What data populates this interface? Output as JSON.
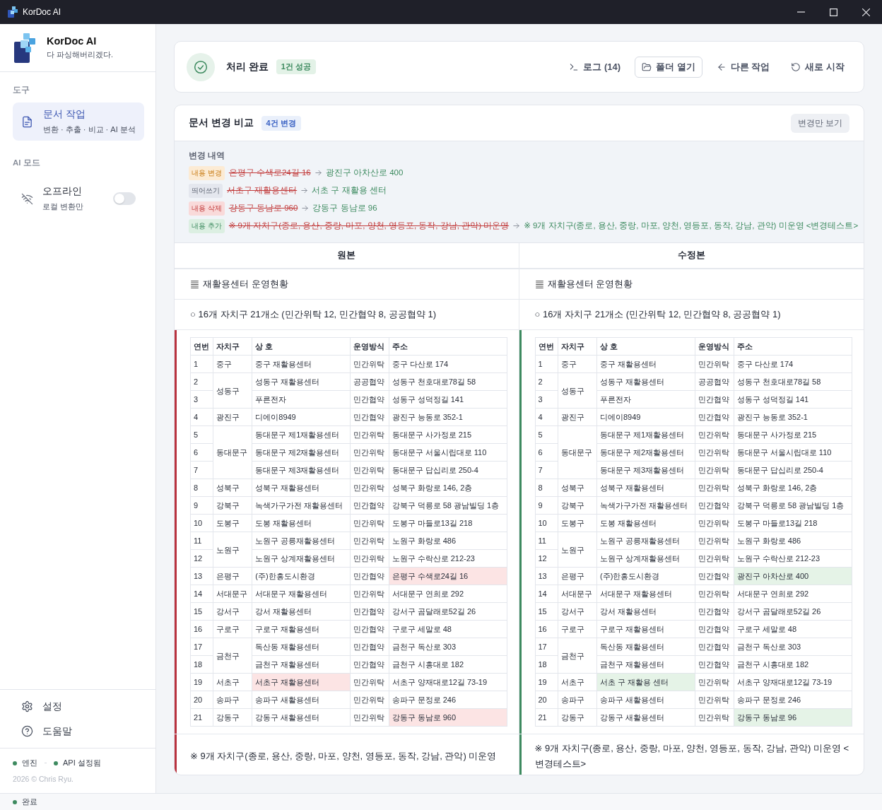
{
  "window": {
    "title": "KorDoc AI"
  },
  "sidebar": {
    "brand": {
      "name": "KorDoc AI",
      "tagline": "다 파싱해버리겠다."
    },
    "tools_label": "도구",
    "nav": [
      {
        "title": "문서 작업",
        "subtitle": "변환 · 추출 · 비교 · AI 분석",
        "selected": true
      }
    ],
    "ai_mode": {
      "label": "AI 모드",
      "title": "오프라인",
      "subtitle": "로컬 변환만",
      "on": false
    },
    "links": [
      {
        "kind": "settings",
        "label": "설정"
      },
      {
        "kind": "help",
        "label": "도움말"
      }
    ],
    "indicators": [
      {
        "label": "엔진",
        "color": "#3d8a5f"
      },
      {
        "label": "API 설정됨",
        "color": "#3d8a5f"
      }
    ],
    "copyright": "2026 © Chris Ryu."
  },
  "result": {
    "title": "처리 완료",
    "badge": "1건 성공",
    "actions": [
      {
        "kind": "log",
        "label": "로그 (14)",
        "outlined": false
      },
      {
        "kind": "folder",
        "label": "폴더 열기",
        "outlined": true
      },
      {
        "kind": "back",
        "label": "다른 작업",
        "outlined": false
      },
      {
        "kind": "restart",
        "label": "새로 시작",
        "outlined": false
      }
    ]
  },
  "comparison": {
    "title": "문서 변경 비교",
    "badge": "4건 변경",
    "filter_button": "변경만 보기",
    "changes_label": "변경 내역",
    "changes": [
      {
        "kind": "modify",
        "label": "내용 변경",
        "old": "은평구 수색로24길 16",
        "new": "광진구 아차산로 400"
      },
      {
        "kind": "spacing",
        "label": "띄어쓰기",
        "old": "서초구 재활용센터",
        "new": "서초 구 재활용 센터"
      },
      {
        "kind": "delete",
        "label": "내용 삭제",
        "old": "강동구 동남로 960",
        "new": "강동구 동남로 96"
      },
      {
        "kind": "add",
        "label": "내용 추가",
        "old": "※ 9개 자치구(종로, 용산, 중랑, 마포, 양천, 영등포, 동작, 강남, 관악) 미운영",
        "new": "※ 9개 자치구(종로, 용산, 중랑, 마포, 양천, 영등포, 동작, 강남, 관악) 미운영 <변경테스트>"
      }
    ],
    "panes": [
      {
        "kind": "original",
        "label": "원본",
        "blocks": [
          {
            "kind": "heading",
            "text": "재활용센터 운영현황",
            "changed": false
          },
          {
            "kind": "paragraph",
            "text": "○ 16개 자치구 21개소 (민간위탁 12, 민간협약 8, 공공협약 1)",
            "changed": false
          },
          {
            "kind": "table",
            "changed": true,
            "columns": [
              "연번",
              "자치구",
              "상 호",
              "운영방식",
              "주소"
            ],
            "groups": [
              {
                "district": "중구",
                "entries": [
                  {
                    "no": "1",
                    "name": "중구 재활용센터",
                    "method": "민간위탁",
                    "address": "중구 다산로 174",
                    "name_changed": false,
                    "address_changed": false
                  }
                ]
              },
              {
                "district": "성동구",
                "entries": [
                  {
                    "no": "2",
                    "name": "성동구 재활용센터",
                    "method": "공공협약",
                    "address": "성동구 천호대로78길 58",
                    "name_changed": false,
                    "address_changed": false
                  },
                  {
                    "no": "3",
                    "name": "푸른전자",
                    "method": "민간협약",
                    "address": "성동구 성덕정길 141",
                    "name_changed": false,
                    "address_changed": false
                  }
                ]
              },
              {
                "district": "광진구",
                "entries": [
                  {
                    "no": "4",
                    "name": "디에이8949",
                    "method": "민간협약",
                    "address": "광진구 능동로 352-1",
                    "name_changed": false,
                    "address_changed": false
                  }
                ]
              },
              {
                "district": "동대문구",
                "entries": [
                  {
                    "no": "5",
                    "name": "동대문구 제1재활용센터",
                    "method": "민간위탁",
                    "address": "동대문구 사가정로 215",
                    "name_changed": false,
                    "address_changed": false
                  },
                  {
                    "no": "6",
                    "name": "동대문구 제2재활용센터",
                    "method": "민간위탁",
                    "address": "동대문구 서울시립대로 110",
                    "name_changed": false,
                    "address_changed": false
                  },
                  {
                    "no": "7",
                    "name": "동대문구 제3재활용센터",
                    "method": "민간위탁",
                    "address": "동대문구 답십리로 250-4",
                    "name_changed": false,
                    "address_changed": false
                  }
                ]
              },
              {
                "district": "성북구",
                "entries": [
                  {
                    "no": "8",
                    "name": "성북구 재활용센터",
                    "method": "민간위탁",
                    "address": "성북구 화랑로 146, 2층",
                    "name_changed": false,
                    "address_changed": false
                  }
                ]
              },
              {
                "district": "강북구",
                "entries": [
                  {
                    "no": "9",
                    "name": "녹색가구가전 재활용센터",
                    "method": "민간협약",
                    "address": "강북구 덕릉로 58 광남빌딩 1층",
                    "name_changed": false,
                    "address_changed": false
                  }
                ]
              },
              {
                "district": "도봉구",
                "entries": [
                  {
                    "no": "10",
                    "name": "도봉 재활용센터",
                    "method": "민간위탁",
                    "address": "도봉구 마들로13길 218",
                    "name_changed": false,
                    "address_changed": false
                  }
                ]
              },
              {
                "district": "노원구",
                "entries": [
                  {
                    "no": "11",
                    "name": "노원구 공릉재활용센터",
                    "method": "민간위탁",
                    "address": "노원구 화랑로 486",
                    "name_changed": false,
                    "address_changed": false
                  },
                  {
                    "no": "12",
                    "name": "노원구 상계재활용센터",
                    "method": "민간위탁",
                    "address": "노원구 수락산로 212-23",
                    "name_changed": false,
                    "address_changed": false
                  }
                ]
              },
              {
                "district": "은평구",
                "entries": [
                  {
                    "no": "13",
                    "name": "(주)한흥도시환경",
                    "method": "민간협약",
                    "address": "은평구 수색로24길 16",
                    "name_changed": false,
                    "address_changed": true
                  }
                ]
              },
              {
                "district": "서대문구",
                "entries": [
                  {
                    "no": "14",
                    "name": "서대문구 재활용센터",
                    "method": "민간위탁",
                    "address": "서대문구 연희로 292",
                    "name_changed": false,
                    "address_changed": false
                  }
                ]
              },
              {
                "district": "강서구",
                "entries": [
                  {
                    "no": "15",
                    "name": "강서 재활용센터",
                    "method": "민간협약",
                    "address": "강서구 곰달래로52길 26",
                    "name_changed": false,
                    "address_changed": false
                  }
                ]
              },
              {
                "district": "구로구",
                "entries": [
                  {
                    "no": "16",
                    "name": "구로구 재활용센터",
                    "method": "민간협약",
                    "address": "구로구 세말로 48",
                    "name_changed": false,
                    "address_changed": false
                  }
                ]
              },
              {
                "district": "금천구",
                "entries": [
                  {
                    "no": "17",
                    "name": "독산동 재활용센터",
                    "method": "민간협약",
                    "address": "금천구 독산로 303",
                    "name_changed": false,
                    "address_changed": false
                  },
                  {
                    "no": "18",
                    "name": "금천구 재활용센터",
                    "method": "민간협약",
                    "address": "금천구 시흥대로 182",
                    "name_changed": false,
                    "address_changed": false
                  }
                ]
              },
              {
                "district": "서초구",
                "entries": [
                  {
                    "no": "19",
                    "name": "서초구 재활용센터",
                    "method": "민간위탁",
                    "address": "서초구 양재대로12길 73-19",
                    "name_changed": true,
                    "address_changed": false
                  }
                ]
              },
              {
                "district": "송파구",
                "entries": [
                  {
                    "no": "20",
                    "name": "송파구 새활용센터",
                    "method": "민간위탁",
                    "address": "송파구 문정로 246",
                    "name_changed": false,
                    "address_changed": false
                  }
                ]
              },
              {
                "district": "강동구",
                "entries": [
                  {
                    "no": "21",
                    "name": "강동구 새활용센터",
                    "method": "민간위탁",
                    "address": "강동구 동남로 960",
                    "name_changed": false,
                    "address_changed": true
                  }
                ]
              }
            ]
          },
          {
            "kind": "paragraph",
            "text": "※ 9개 자치구(종로, 용산, 중랑, 마포, 양천, 영등포, 동작, 강남, 관악) 미운영",
            "changed": true
          }
        ]
      },
      {
        "kind": "revised",
        "label": "수정본",
        "blocks": [
          {
            "kind": "heading",
            "text": "재활용센터 운영현황",
            "changed": false
          },
          {
            "kind": "paragraph",
            "text": "○ 16개 자치구 21개소 (민간위탁 12, 민간협약 8, 공공협약 1)",
            "changed": false
          },
          {
            "kind": "table",
            "changed": true,
            "columns": [
              "연번",
              "자치구",
              "상 호",
              "운영방식",
              "주소"
            ],
            "groups": [
              {
                "district": "중구",
                "entries": [
                  {
                    "no": "1",
                    "name": "중구 재활용센터",
                    "method": "민간위탁",
                    "address": "중구 다산로 174",
                    "name_changed": false,
                    "address_changed": false
                  }
                ]
              },
              {
                "district": "성동구",
                "entries": [
                  {
                    "no": "2",
                    "name": "성동구 재활용센터",
                    "method": "공공협약",
                    "address": "성동구 천호대로78길 58",
                    "name_changed": false,
                    "address_changed": false
                  },
                  {
                    "no": "3",
                    "name": "푸른전자",
                    "method": "민간협약",
                    "address": "성동구 성덕정길 141",
                    "name_changed": false,
                    "address_changed": false
                  }
                ]
              },
              {
                "district": "광진구",
                "entries": [
                  {
                    "no": "4",
                    "name": "디에이8949",
                    "method": "민간협약",
                    "address": "광진구 능동로 352-1",
                    "name_changed": false,
                    "address_changed": false
                  }
                ]
              },
              {
                "district": "동대문구",
                "entries": [
                  {
                    "no": "5",
                    "name": "동대문구 제1재활용센터",
                    "method": "민간위탁",
                    "address": "동대문구 사가정로 215",
                    "name_changed": false,
                    "address_changed": false
                  },
                  {
                    "no": "6",
                    "name": "동대문구 제2재활용센터",
                    "method": "민간위탁",
                    "address": "동대문구 서울시립대로 110",
                    "name_changed": false,
                    "address_changed": false
                  },
                  {
                    "no": "7",
                    "name": "동대문구 제3재활용센터",
                    "method": "민간위탁",
                    "address": "동대문구 답십리로 250-4",
                    "name_changed": false,
                    "address_changed": false
                  }
                ]
              },
              {
                "district": "성북구",
                "entries": [
                  {
                    "no": "8",
                    "name": "성북구 재활용센터",
                    "method": "민간위탁",
                    "address": "성북구 화랑로 146, 2층",
                    "name_changed": false,
                    "address_changed": false
                  }
                ]
              },
              {
                "district": "강북구",
                "entries": [
                  {
                    "no": "9",
                    "name": "녹색가구가전 재활용센터",
                    "method": "민간협약",
                    "address": "강북구 덕릉로 58 광남빌딩 1층",
                    "name_changed": false,
                    "address_changed": false
                  }
                ]
              },
              {
                "district": "도봉구",
                "entries": [
                  {
                    "no": "10",
                    "name": "도봉 재활용센터",
                    "method": "민간위탁",
                    "address": "도봉구 마들로13길 218",
                    "name_changed": false,
                    "address_changed": false
                  }
                ]
              },
              {
                "district": "노원구",
                "entries": [
                  {
                    "no": "11",
                    "name": "노원구 공릉재활용센터",
                    "method": "민간위탁",
                    "address": "노원구 화랑로 486",
                    "name_changed": false,
                    "address_changed": false
                  },
                  {
                    "no": "12",
                    "name": "노원구 상계재활용센터",
                    "method": "민간위탁",
                    "address": "노원구 수락산로 212-23",
                    "name_changed": false,
                    "address_changed": false
                  }
                ]
              },
              {
                "district": "은평구",
                "entries": [
                  {
                    "no": "13",
                    "name": "(주)한흥도시환경",
                    "method": "민간협약",
                    "address": "광진구 아차산로 400",
                    "name_changed": false,
                    "address_changed": true
                  }
                ]
              },
              {
                "district": "서대문구",
                "entries": [
                  {
                    "no": "14",
                    "name": "서대문구 재활용센터",
                    "method": "민간위탁",
                    "address": "서대문구 연희로 292",
                    "name_changed": false,
                    "address_changed": false
                  }
                ]
              },
              {
                "district": "강서구",
                "entries": [
                  {
                    "no": "15",
                    "name": "강서 재활용센터",
                    "method": "민간협약",
                    "address": "강서구 곰달래로52길 26",
                    "name_changed": false,
                    "address_changed": false
                  }
                ]
              },
              {
                "district": "구로구",
                "entries": [
                  {
                    "no": "16",
                    "name": "구로구 재활용센터",
                    "method": "민간협약",
                    "address": "구로구 세말로 48",
                    "name_changed": false,
                    "address_changed": false
                  }
                ]
              },
              {
                "district": "금천구",
                "entries": [
                  {
                    "no": "17",
                    "name": "독산동 재활용센터",
                    "method": "민간협약",
                    "address": "금천구 독산로 303",
                    "name_changed": false,
                    "address_changed": false
                  },
                  {
                    "no": "18",
                    "name": "금천구 재활용센터",
                    "method": "민간협약",
                    "address": "금천구 시흥대로 182",
                    "name_changed": false,
                    "address_changed": false
                  }
                ]
              },
              {
                "district": "서초구",
                "entries": [
                  {
                    "no": "19",
                    "name": "서초 구 재활용 센터",
                    "method": "민간위탁",
                    "address": "서초구 양재대로12길 73-19",
                    "name_changed": true,
                    "address_changed": false
                  }
                ]
              },
              {
                "district": "송파구",
                "entries": [
                  {
                    "no": "20",
                    "name": "송파구 새활용센터",
                    "method": "민간위탁",
                    "address": "송파구 문정로 246",
                    "name_changed": false,
                    "address_changed": false
                  }
                ]
              },
              {
                "district": "강동구",
                "entries": [
                  {
                    "no": "21",
                    "name": "강동구 새활용센터",
                    "method": "민간위탁",
                    "address": "강동구 동남로 96",
                    "name_changed": false,
                    "address_changed": true
                  }
                ]
              }
            ]
          },
          {
            "kind": "paragraph",
            "text": "※ 9개 자치구(종로, 용산, 중랑, 마포, 양천, 영등포, 동작, 강남, 관악) 미운영 <변경테스트>",
            "changed": true
          }
        ]
      }
    ]
  },
  "status_bar": {
    "label": "완료",
    "color": "#3d8a5f"
  }
}
